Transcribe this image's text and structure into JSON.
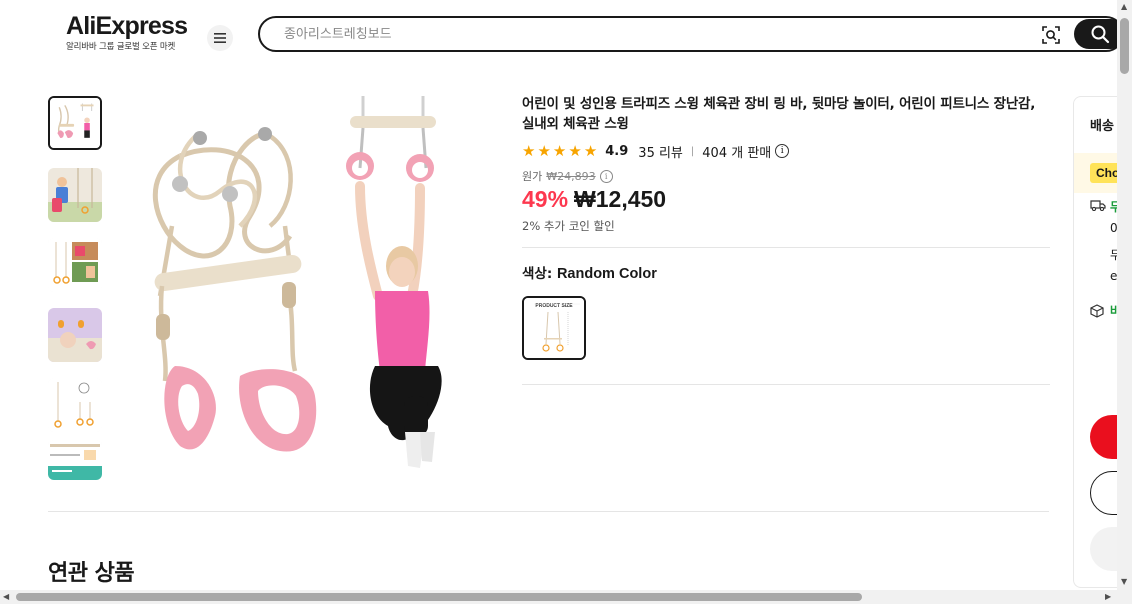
{
  "header": {
    "logo_text": "AliExpress",
    "logo_subtitle": "알리바바 그룹 글로벌 오픈 마켓",
    "search_placeholder": "종아리스트레칭보드"
  },
  "product": {
    "title": "어린이 및 성인용 트라피즈 스윙 체육관 장비 링 바, 뒷마당 놀이터, 어린이 피트니스 장난감, 실내외 체육관 스윙",
    "rating": "4.9",
    "stars": 5,
    "reviews": "35 리뷰",
    "separator": "|",
    "sold": "404 개 판매",
    "original_label": "원가",
    "original_price": "₩24,893",
    "discount": "49%",
    "price": "₩12,450",
    "coin_discount": "2% 추가 코인 할인",
    "color_label": "색상:",
    "color_value": "Random Color",
    "swatch_text": "PRODUCT SIZE"
  },
  "panel": {
    "shipping_title": "배송",
    "choice_badge": "Choice",
    "delivery_text": "무",
    "line1": "0",
    "line2": "두",
    "line3": "e",
    "protection_text": "바"
  },
  "related_title": "연관 상품",
  "colors": {
    "discount_red": "#fd384f",
    "star": "#f7a400",
    "buy_red": "#ea0f1e",
    "choice_yellow": "#ffe359",
    "delivery_green": "#1a9b3a"
  },
  "icons": [
    "menu-icon",
    "camera-search-icon",
    "search-icon",
    "info-icon",
    "truck-icon",
    "shield-icon"
  ]
}
